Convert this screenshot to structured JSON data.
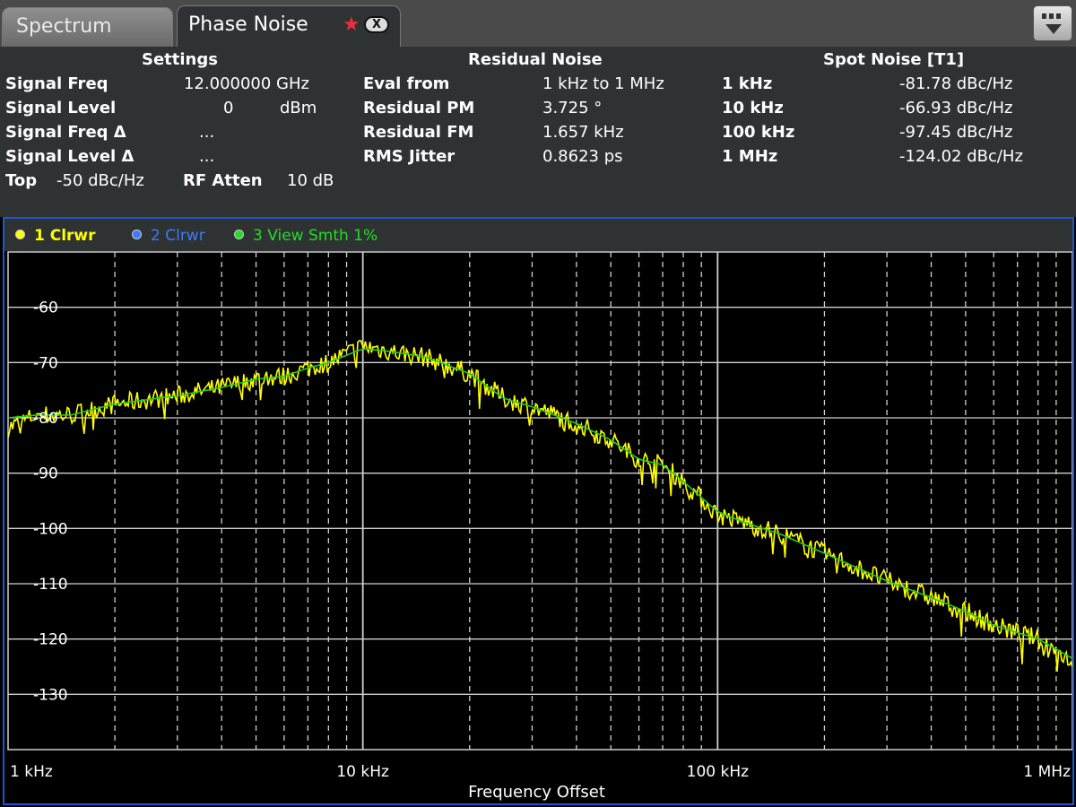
{
  "tabs": {
    "spectrum": "Spectrum",
    "phase_noise": "Phase Noise"
  },
  "settings": {
    "title": "Settings",
    "rows": [
      {
        "label": "Signal Freq",
        "value": "12.000000 GHz"
      },
      {
        "label": "Signal Level",
        "value": "0",
        "unit": "dBm"
      },
      {
        "label": "Signal Freq Δ",
        "value": "..."
      },
      {
        "label": "Signal Level Δ",
        "value": "..."
      }
    ],
    "top_label": "Top",
    "top_value": "-50 dBc/Hz",
    "rf_atten_label": "RF Atten",
    "rf_atten_value": "10 dB"
  },
  "residual_noise": {
    "title": "Residual Noise",
    "rows": [
      {
        "label": "Eval from",
        "value": "1 kHz to 1 MHz"
      },
      {
        "label": "Residual PM",
        "value": "3.725 °"
      },
      {
        "label": "Residual FM",
        "value": "1.657 kHz"
      },
      {
        "label": "RMS Jitter",
        "value": "0.8623 ps"
      }
    ]
  },
  "spot_noise": {
    "title": "Spot Noise [T1]",
    "rows": [
      {
        "label": "1 kHz",
        "value": "-81.78 dBc/Hz"
      },
      {
        "label": "10 kHz",
        "value": "-66.93 dBc/Hz"
      },
      {
        "label": "100 kHz",
        "value": "-97.45 dBc/Hz"
      },
      {
        "label": "1 MHz",
        "value": "-124.02 dBc/Hz"
      }
    ]
  },
  "traces": [
    {
      "label": "1 Clrwr",
      "color": "#ffff00"
    },
    {
      "label": "2 Clrwr",
      "color": "#3a7bff"
    },
    {
      "label": "3 View Smth 1%",
      "color": "#22dd22"
    }
  ],
  "colors": {
    "trace1": "#ffff00",
    "trace3": "#22cc22",
    "grid": "#cfcfcf",
    "tab_active_bg": "#2f3233",
    "diagram_border": "#1f57c9"
  },
  "chart_data": {
    "type": "line",
    "x_scale": "log",
    "xlim_hz": [
      1000,
      1000000
    ],
    "ylim": [
      -140,
      -50
    ],
    "y_ticks": [
      -60,
      -70,
      -80,
      -90,
      -100,
      -110,
      -120,
      -130
    ],
    "x_tick_labels": [
      {
        "value_hz": 1000,
        "label": "1 kHz"
      },
      {
        "value_hz": 10000,
        "label": "10 kHz"
      },
      {
        "value_hz": 100000,
        "label": "100 kHz"
      },
      {
        "value_hz": 1000000,
        "label": "1 MHz"
      }
    ],
    "xlabel": "Frequency Offset",
    "grid": true,
    "series": [
      {
        "name": "1 Clrwr",
        "x_hz": [
          1000,
          1200,
          1500,
          2000,
          3000,
          4000,
          5000,
          6000,
          7000,
          8000,
          10000,
          12000,
          15000,
          20000,
          25000,
          30000,
          40000,
          50000,
          60000,
          70000,
          80000,
          100000,
          120000,
          150000,
          200000,
          300000,
          400000,
          500000,
          600000,
          800000,
          1000000
        ],
        "y": [
          -81.8,
          -79.5,
          -79.5,
          -77.5,
          -76.0,
          -74.5,
          -73.0,
          -72.5,
          -71.0,
          -70.0,
          -67.0,
          -68.0,
          -69.0,
          -72.0,
          -76.5,
          -78.0,
          -81.0,
          -84.0,
          -87.5,
          -88.5,
          -91.5,
          -97.5,
          -99.0,
          -101.0,
          -104.5,
          -109.5,
          -112.5,
          -115.0,
          -117.5,
          -120.0,
          -124.0
        ],
        "noise_db": 1.8
      },
      {
        "name": "3 View Smth 1%",
        "x_hz": [
          1000,
          1200,
          1500,
          2000,
          3000,
          4000,
          5000,
          6000,
          7000,
          8000,
          10000,
          12000,
          15000,
          20000,
          25000,
          30000,
          40000,
          50000,
          60000,
          70000,
          80000,
          100000,
          120000,
          150000,
          200000,
          300000,
          400000,
          500000,
          600000,
          800000,
          1000000
        ],
        "y": [
          -80.0,
          -79.5,
          -79.5,
          -77.5,
          -76.0,
          -74.5,
          -73.0,
          -72.5,
          -71.0,
          -70.0,
          -67.5,
          -68.0,
          -69.0,
          -72.0,
          -76.5,
          -78.0,
          -81.0,
          -84.0,
          -87.5,
          -88.5,
          -91.5,
          -97.0,
          -99.0,
          -101.0,
          -104.5,
          -109.5,
          -112.5,
          -115.0,
          -117.5,
          -120.0,
          -123.5
        ]
      }
    ]
  }
}
